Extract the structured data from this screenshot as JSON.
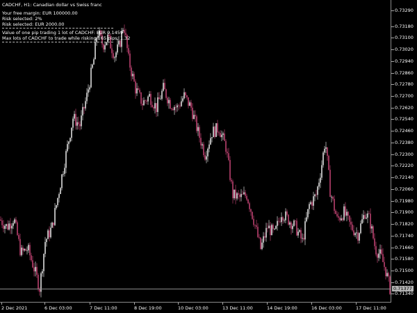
{
  "chart_title": "CADCHF, H1:  Canadian dollar vs Swiss franc",
  "info_panel": {
    "free_margin": "Your free margin: EUR 100000.00",
    "risk_percent": "Risk selected: 2%",
    "risk_amount": "Risk selected: EUR 2000.00",
    "pip_value": "Value of one pip trading 1 lot of CADCHF: EUR 9.1459",
    "max_lots": "Max lots of CADCHF  to trade while risking 165 pips: 1.32"
  },
  "colors": {
    "background": "#000000",
    "bull_candle": "#ffffff",
    "bear_candle": "#d64a7f",
    "current_price_line": "#8c8c8c",
    "text": "#ffffff"
  },
  "price_axis": {
    "labels": [
      "0.73290",
      "0.73180",
      "0.73100",
      "0.73020",
      "0.72940",
      "0.72860",
      "0.72780",
      "0.72700",
      "0.72620",
      "0.72540",
      "0.72460",
      "0.72380",
      "0.72300",
      "0.72220",
      "0.72140",
      "0.72060",
      "0.71980",
      "0.71900",
      "0.71820",
      "0.71740",
      "0.71660",
      "0.71580",
      "0.71500",
      "0.71420",
      "0.71340"
    ],
    "current_price": "0.71377"
  },
  "time_axis": {
    "labels": [
      "2 Dec 2021",
      "6 Dec 03:00",
      "7 Dec 11:00",
      "8 Dec 19:00",
      "10 Dec 03:00",
      "13 Dec 11:00",
      "14 Dec 19:00",
      "16 Dec 03:00",
      "17 Dec 11:00"
    ]
  },
  "chart_data": {
    "type": "candlestick",
    "symbol": "CADCHF",
    "timeframe": "H1",
    "ylim": [
      0.7128,
      0.7336
    ],
    "close_path": [
      [
        0,
        0.7185
      ],
      [
        10,
        0.718
      ],
      [
        20,
        0.7186
      ],
      [
        30,
        0.7162
      ],
      [
        40,
        0.7165
      ],
      [
        50,
        0.715
      ],
      [
        57,
        0.7138
      ],
      [
        65,
        0.717
      ],
      [
        75,
        0.718
      ],
      [
        85,
        0.7205
      ],
      [
        95,
        0.723
      ],
      [
        105,
        0.7255
      ],
      [
        115,
        0.725
      ],
      [
        125,
        0.727
      ],
      [
        135,
        0.7295
      ],
      [
        140,
        0.7315
      ],
      [
        148,
        0.7305
      ],
      [
        155,
        0.731
      ],
      [
        165,
        0.7298
      ],
      [
        172,
        0.7305
      ],
      [
        178,
        0.732
      ],
      [
        185,
        0.7295
      ],
      [
        195,
        0.7275
      ],
      [
        205,
        0.7265
      ],
      [
        215,
        0.727
      ],
      [
        225,
        0.7262
      ],
      [
        235,
        0.7275
      ],
      [
        245,
        0.7265
      ],
      [
        255,
        0.7262
      ],
      [
        265,
        0.727
      ],
      [
        275,
        0.7262
      ],
      [
        285,
        0.7245
      ],
      [
        295,
        0.723
      ],
      [
        305,
        0.7245
      ],
      [
        315,
        0.7248
      ],
      [
        325,
        0.7235
      ],
      [
        335,
        0.7202
      ],
      [
        345,
        0.72
      ],
      [
        355,
        0.7202
      ],
      [
        365,
        0.7185
      ],
      [
        375,
        0.7165
      ],
      [
        385,
        0.718
      ],
      [
        395,
        0.7175
      ],
      [
        405,
        0.719
      ],
      [
        415,
        0.7185
      ],
      [
        425,
        0.718
      ],
      [
        435,
        0.717
      ],
      [
        445,
        0.7195
      ],
      [
        455,
        0.7202
      ],
      [
        462,
        0.722
      ],
      [
        468,
        0.724
      ],
      [
        475,
        0.7205
      ],
      [
        485,
        0.7185
      ],
      [
        495,
        0.719
      ],
      [
        505,
        0.718
      ],
      [
        515,
        0.7175
      ],
      [
        525,
        0.719
      ],
      [
        532,
        0.7185
      ],
      [
        540,
        0.7165
      ],
      [
        548,
        0.716
      ],
      [
        555,
        0.715
      ],
      [
        561,
        0.71377
      ]
    ]
  }
}
